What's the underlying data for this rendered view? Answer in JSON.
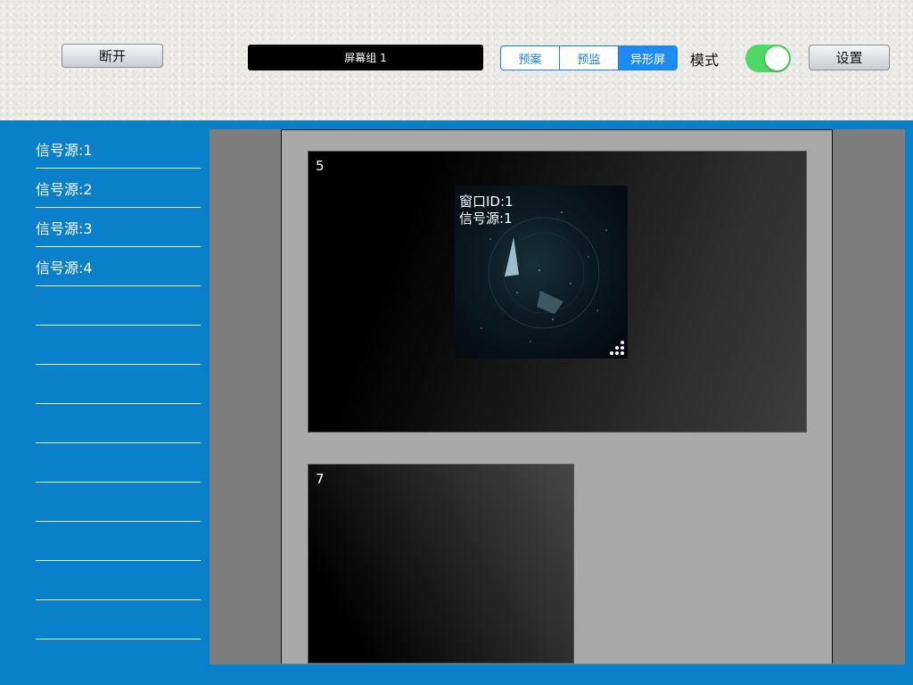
{
  "toolbar": {
    "disconnect_label": "断开",
    "screen_group": "屏幕组 1",
    "segments": [
      {
        "label": "预案",
        "active": false
      },
      {
        "label": "预监",
        "active": false
      },
      {
        "label": "异形屏",
        "active": true
      }
    ],
    "mode_label": "模式",
    "mode_toggle_on": true,
    "settings_label": "设置"
  },
  "sidebar": {
    "items": [
      {
        "label": "信号源:1"
      },
      {
        "label": "信号源:2"
      },
      {
        "label": "信号源:3"
      },
      {
        "label": "信号源:4"
      },
      {
        "label": ""
      },
      {
        "label": ""
      },
      {
        "label": ""
      },
      {
        "label": ""
      },
      {
        "label": ""
      },
      {
        "label": ""
      },
      {
        "label": ""
      },
      {
        "label": ""
      },
      {
        "label": ""
      }
    ]
  },
  "wall": {
    "screens": [
      {
        "number": "5"
      },
      {
        "number": "7"
      }
    ],
    "window": {
      "id_text": "窗口ID:1",
      "source_text": "信号源:1"
    }
  },
  "colors": {
    "background_blue": "#0a7fca",
    "segment_blue": "#1d8cf2",
    "toggle_green": "#4cd964"
  }
}
